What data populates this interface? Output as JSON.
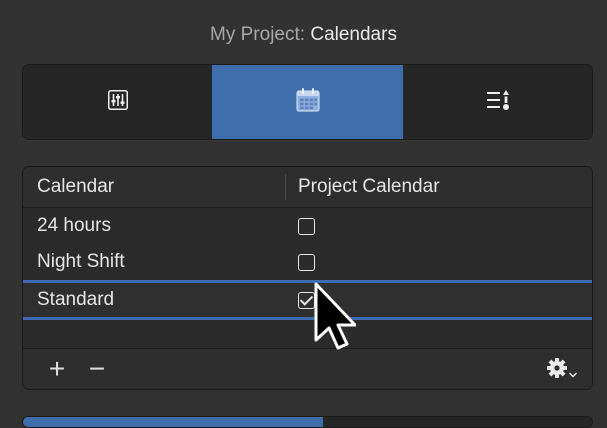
{
  "window": {
    "title_prefix": "My Project:",
    "title_main": "Calendars"
  },
  "segments": [
    {
      "icon": "sliders-icon",
      "selected": false
    },
    {
      "icon": "calendar-icon",
      "selected": true
    },
    {
      "icon": "list-sort-icon",
      "selected": false
    }
  ],
  "table": {
    "columns": [
      "Calendar",
      "Project Calendar"
    ],
    "rows": [
      {
        "name": "24 hours",
        "project_calendar": false
      },
      {
        "name": "Night Shift",
        "project_calendar": false
      },
      {
        "name": "Standard",
        "project_calendar": true,
        "selected": true
      }
    ]
  },
  "footer": {
    "add_label": "+",
    "remove_label": "−",
    "gear_icon": "gear-icon"
  },
  "colors": {
    "accent": "#3f6ead",
    "background": "#323232"
  }
}
